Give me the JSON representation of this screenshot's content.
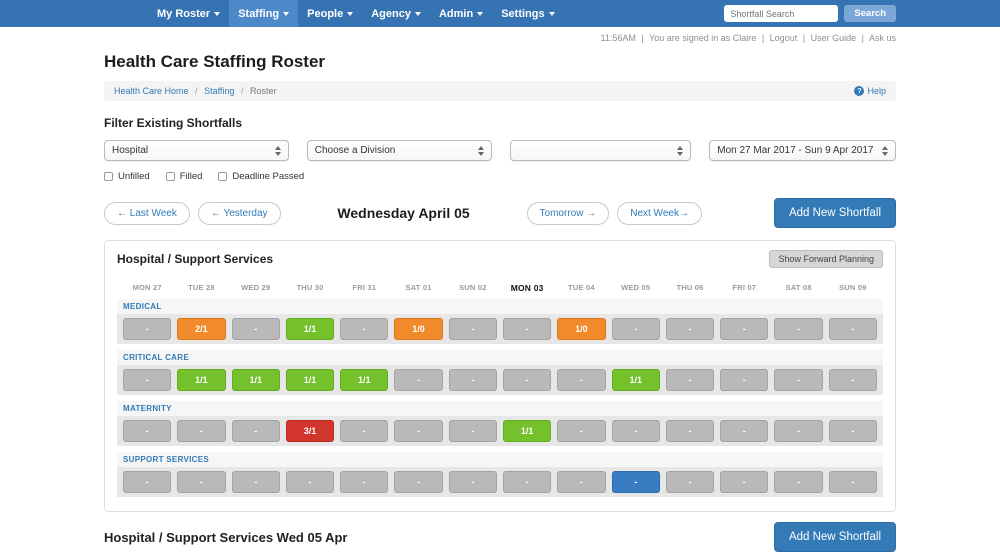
{
  "navbar": {
    "items": [
      {
        "label": "My Roster",
        "active": false
      },
      {
        "label": "Staffing",
        "active": true
      },
      {
        "label": "People",
        "active": false
      },
      {
        "label": "Agency",
        "active": false
      },
      {
        "label": "Admin",
        "active": false
      },
      {
        "label": "Settings",
        "active": false
      }
    ],
    "search_placeholder": "Shortfall Search",
    "search_button": "Search"
  },
  "session": {
    "time": "11:56AM",
    "signed_in": "You are signed in as Claire",
    "separator": "|",
    "links": [
      "Logout",
      "User Guide",
      "Ask us"
    ]
  },
  "page_title": "Health Care Staffing Roster",
  "breadcrumb": {
    "separator": "/",
    "items": [
      "Health Care Home",
      "Staffing",
      "Roster"
    ],
    "help_label": "Help",
    "help_icon": "?"
  },
  "filter": {
    "heading": "Filter Existing Shortfalls",
    "selects": [
      "Hospital",
      "Choose a Division",
      "",
      "Mon 27 Mar 2017 - Sun 9 Apr 2017"
    ],
    "checkboxes": [
      "Unfilled",
      "Filled",
      "Deadline Passed"
    ]
  },
  "week_nav": {
    "last_week": "← Last Week",
    "yesterday": "← Yesterday",
    "current_day": "Wednesday April 05",
    "tomorrow": "Tomorrow →",
    "next_week": "Next Week→",
    "add_shortfall": "Add New Shortfall"
  },
  "roster": {
    "title": "Hospital / Support Services",
    "forward_planning_button": "Show Forward Planning",
    "days": [
      "MON 27",
      "TUE 28",
      "WED 29",
      "THU 30",
      "FRI 31",
      "SAT 01",
      "SUN 02",
      "MON 03",
      "TUE 04",
      "WED 05",
      "THU 06",
      "FRI 07",
      "SAT 08",
      "SUN 09"
    ],
    "today_index": 7,
    "colors": {
      "gray": "#b9b9b9",
      "orange": "#f18a2b",
      "green": "#74c12c",
      "red": "#d2352c",
      "blue": "#3a7cc1"
    },
    "rows": [
      {
        "label": "MEDICAL",
        "cells": [
          {
            "text": "-",
            "color": "gray"
          },
          {
            "text": "2/1",
            "color": "orange"
          },
          {
            "text": "-",
            "color": "gray"
          },
          {
            "text": "1/1",
            "color": "green"
          },
          {
            "text": "-",
            "color": "gray"
          },
          {
            "text": "1/0",
            "color": "orange"
          },
          {
            "text": "-",
            "color": "gray"
          },
          {
            "text": "-",
            "color": "gray"
          },
          {
            "text": "1/0",
            "color": "orange"
          },
          {
            "text": "-",
            "color": "gray"
          },
          {
            "text": "-",
            "color": "gray"
          },
          {
            "text": "-",
            "color": "gray"
          },
          {
            "text": "-",
            "color": "gray"
          },
          {
            "text": "-",
            "color": "gray"
          }
        ]
      },
      {
        "label": "CRITICAL CARE",
        "cells": [
          {
            "text": "-",
            "color": "gray"
          },
          {
            "text": "1/1",
            "color": "green"
          },
          {
            "text": "1/1",
            "color": "green"
          },
          {
            "text": "1/1",
            "color": "green"
          },
          {
            "text": "1/1",
            "color": "green"
          },
          {
            "text": "-",
            "color": "gray"
          },
          {
            "text": "-",
            "color": "gray"
          },
          {
            "text": "-",
            "color": "gray"
          },
          {
            "text": "-",
            "color": "gray"
          },
          {
            "text": "1/1",
            "color": "green"
          },
          {
            "text": "-",
            "color": "gray"
          },
          {
            "text": "-",
            "color": "gray"
          },
          {
            "text": "-",
            "color": "gray"
          },
          {
            "text": "-",
            "color": "gray"
          }
        ]
      },
      {
        "label": "MATERNITY",
        "cells": [
          {
            "text": "-",
            "color": "gray"
          },
          {
            "text": "-",
            "color": "gray"
          },
          {
            "text": "-",
            "color": "gray"
          },
          {
            "text": "3/1",
            "color": "red"
          },
          {
            "text": "-",
            "color": "gray"
          },
          {
            "text": "-",
            "color": "gray"
          },
          {
            "text": "-",
            "color": "gray"
          },
          {
            "text": "1/1",
            "color": "green"
          },
          {
            "text": "-",
            "color": "gray"
          },
          {
            "text": "-",
            "color": "gray"
          },
          {
            "text": "-",
            "color": "gray"
          },
          {
            "text": "-",
            "color": "gray"
          },
          {
            "text": "-",
            "color": "gray"
          },
          {
            "text": "-",
            "color": "gray"
          }
        ]
      },
      {
        "label": "SUPPORT SERVICES",
        "cells": [
          {
            "text": "-",
            "color": "gray"
          },
          {
            "text": "-",
            "color": "gray"
          },
          {
            "text": "-",
            "color": "gray"
          },
          {
            "text": "-",
            "color": "gray"
          },
          {
            "text": "-",
            "color": "gray"
          },
          {
            "text": "-",
            "color": "gray"
          },
          {
            "text": "-",
            "color": "gray"
          },
          {
            "text": "-",
            "color": "gray"
          },
          {
            "text": "-",
            "color": "gray"
          },
          {
            "text": "-",
            "color": "blue"
          },
          {
            "text": "-",
            "color": "gray"
          },
          {
            "text": "-",
            "color": "gray"
          },
          {
            "text": "-",
            "color": "gray"
          },
          {
            "text": "-",
            "color": "gray"
          }
        ]
      }
    ]
  },
  "footer": {
    "title": "Hospital / Support Services Wed 05 Apr",
    "add_shortfall": "Add New Shortfall"
  }
}
